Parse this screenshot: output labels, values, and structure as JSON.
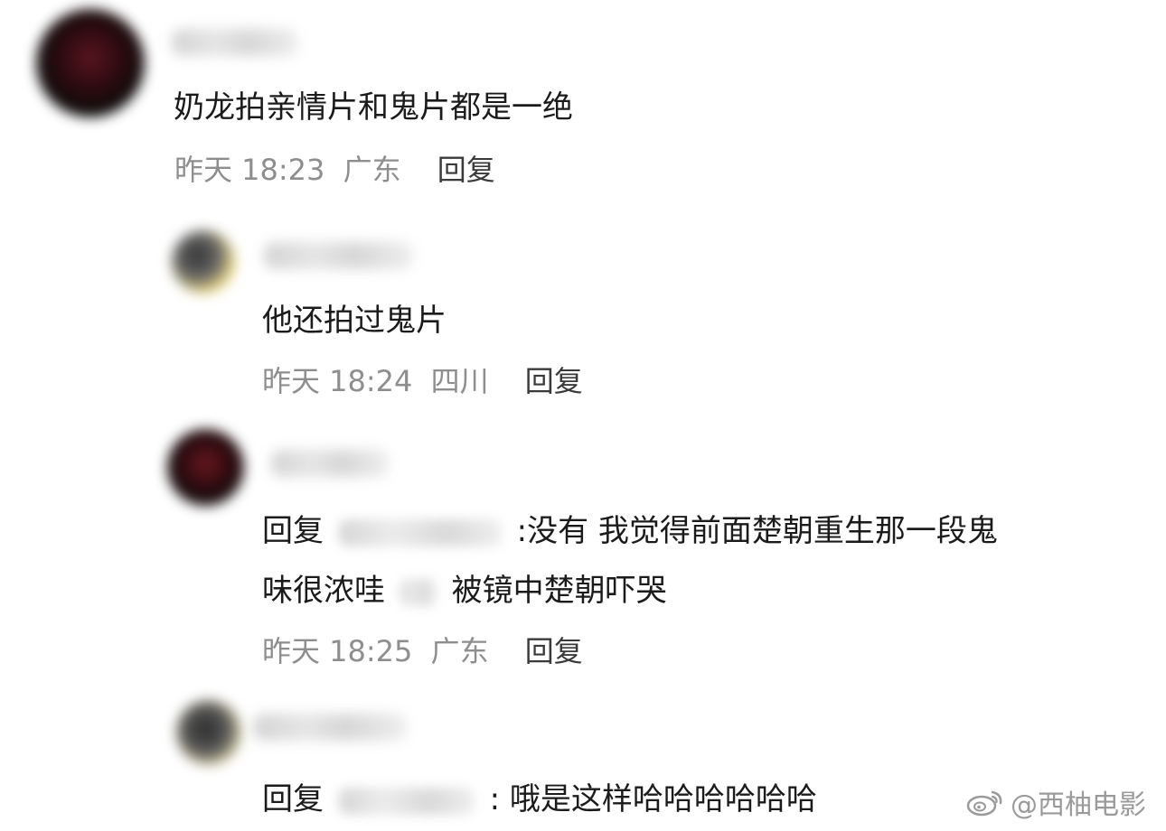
{
  "comments": [
    {
      "text": "奶龙拍亲情片和鬼片都是一绝",
      "time": "昨天 18:23",
      "location": "广东",
      "reply_label": "回复"
    },
    {
      "text": "他还拍过鬼片",
      "time": "昨天 18:24",
      "location": "四川",
      "reply_label": "回复"
    },
    {
      "reply_prefix": "回复",
      "line1_after": ":没有 我觉得前面楚朝重生那一段鬼",
      "line2_a": "味很浓哇",
      "line2_b": "被镜中楚朝吓哭",
      "time": "昨天 18:25",
      "location": "广东",
      "reply_label": "回复"
    },
    {
      "reply_prefix": "回复",
      "text_after": ": 哦是这样哈哈哈哈哈哈"
    }
  ],
  "watermark": {
    "text": "@西柚电影",
    "icon": "weibo-icon"
  }
}
